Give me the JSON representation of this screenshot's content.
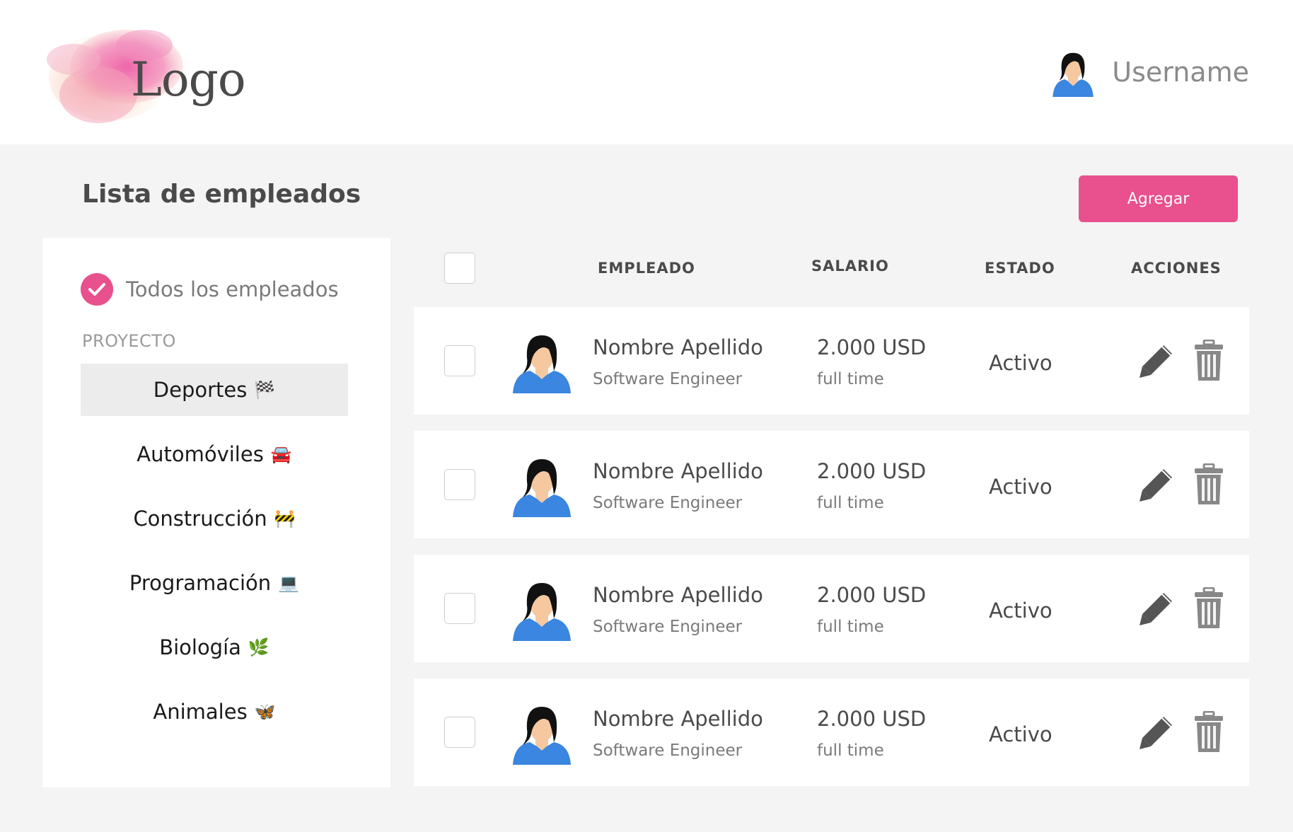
{
  "header": {
    "logo_text": "Logo",
    "username": "Username"
  },
  "page": {
    "title": "Lista de empleados",
    "add_label": "Agregar"
  },
  "sidebar": {
    "all_label": "Todos los empleados",
    "section_label": "PROYECTO",
    "categories": [
      {
        "label": "Deportes",
        "emoji": "🏁",
        "active": true
      },
      {
        "label": "Automóviles",
        "emoji": "🚘",
        "active": false
      },
      {
        "label": "Construcción",
        "emoji": "🚧",
        "active": false
      },
      {
        "label": "Programación",
        "emoji": "💻",
        "active": false
      },
      {
        "label": "Biología",
        "emoji": "🌿",
        "active": false
      },
      {
        "label": "Animales",
        "emoji": "🦋",
        "active": false
      }
    ]
  },
  "table": {
    "columns": [
      "EMPLEADO",
      "SALARIO",
      "ESTADO",
      "ACCIONES"
    ],
    "rows": [
      {
        "name": "Nombre Apellido",
        "role": "Software Engineer",
        "salary": "2.000 USD",
        "salary_type": "full time",
        "status": "Activo"
      },
      {
        "name": "Nombre Apellido",
        "role": "Software Engineer",
        "salary": "2.000 USD",
        "salary_type": "full time",
        "status": "Activo"
      },
      {
        "name": "Nombre Apellido",
        "role": "Software Engineer",
        "salary": "2.000 USD",
        "salary_type": "full time",
        "status": "Activo"
      },
      {
        "name": "Nombre Apellido",
        "role": "Software Engineer",
        "salary": "2.000 USD",
        "salary_type": "full time",
        "status": "Activo"
      }
    ]
  },
  "colors": {
    "accent": "#e8508e",
    "background": "#f4f4f4",
    "avatar_shirt": "#3a86e0"
  },
  "icons": [
    "check-icon",
    "edit-icon",
    "trash-icon",
    "avatar-icon"
  ]
}
